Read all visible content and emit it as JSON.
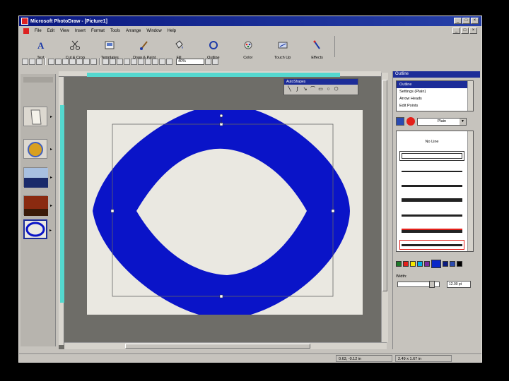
{
  "window": {
    "title": "Microsoft PhotoDraw - [Picture1]",
    "buttons": [
      "_",
      "□",
      "×"
    ]
  },
  "menubar": {
    "items": [
      "File",
      "Edit",
      "View",
      "Insert",
      "Format",
      "Tools",
      "Arrange",
      "Window",
      "Help"
    ]
  },
  "big_toolbar": {
    "items": [
      {
        "label": "Text",
        "icon": "text-icon"
      },
      {
        "label": "Cut & Crop",
        "icon": "scissors-icon"
      },
      {
        "label": "Templates",
        "icon": "templates-icon"
      },
      {
        "label": "Draw & Paint",
        "icon": "brush-icon"
      },
      {
        "label": "Fill",
        "icon": "fill-icon"
      },
      {
        "label": "Outline",
        "icon": "outline-icon"
      },
      {
        "label": "Color",
        "icon": "color-icon"
      },
      {
        "label": "Touch Up",
        "icon": "touchup-icon"
      },
      {
        "label": "Effects",
        "icon": "effects-icon"
      }
    ]
  },
  "small_toolbar": {
    "zoom": "40%"
  },
  "floating_toolbar": {
    "title": "AutoShapes"
  },
  "right_panel": {
    "title": "Outline",
    "tree": [
      "Outline",
      "Settings (Plain)",
      "Arrow Heads",
      "Edit Points"
    ],
    "style_select": "Plain",
    "line_first": "No Line",
    "width_label": "Width:",
    "width_value": "12.00 pt"
  },
  "swatch_colors": [
    "#1e7a2a",
    "#e3201a",
    "#f5e800",
    "#00b0e8",
    "#7a2aa0",
    "#0a28c8",
    "#0a1a80",
    "#2a4ab0",
    "#000000"
  ],
  "shape": {
    "fill_color": "#0a14c8",
    "picture_color": "#eae8e1"
  },
  "statusbar": {
    "coords": "0.63, -0.12 in",
    "size": "2.49 x 1.67 in"
  }
}
